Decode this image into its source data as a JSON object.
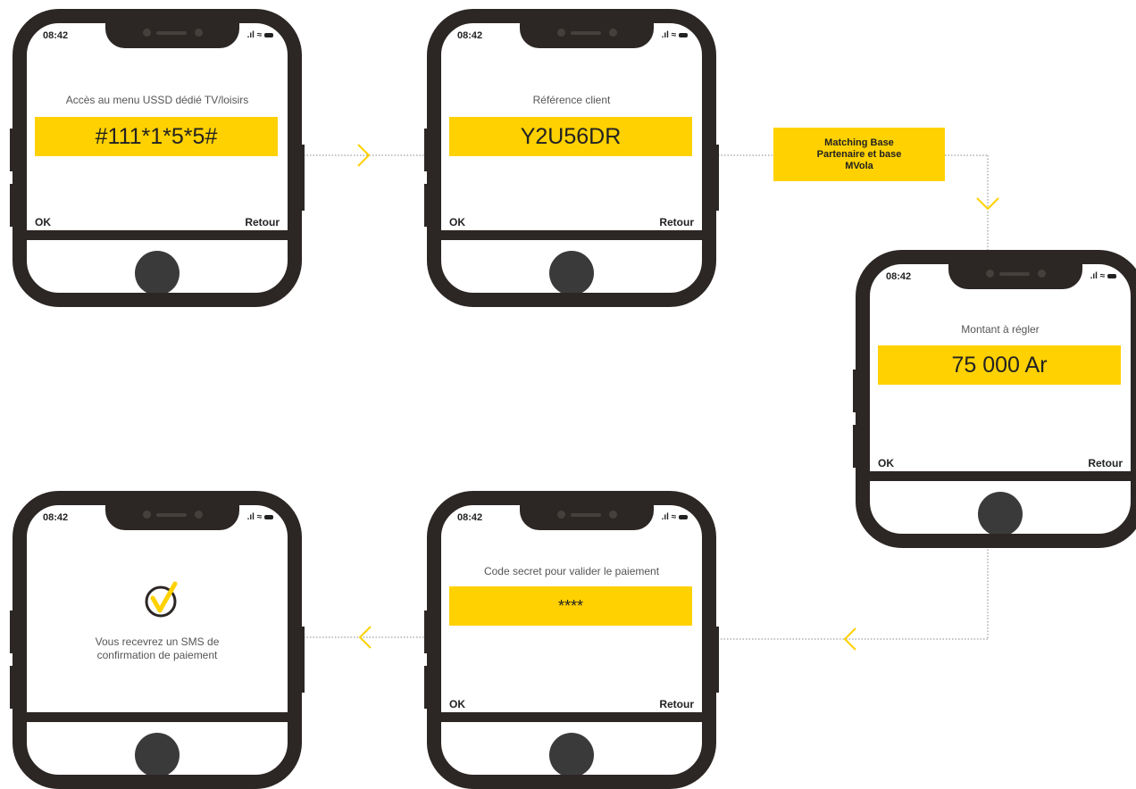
{
  "colors": {
    "frame": "#2c2624",
    "accent": "#ffd100",
    "home_button": "#3a3a3a"
  },
  "phones": [
    {
      "time": "08:42",
      "prompt": "Accès au menu USSD dédié TV/loisirs",
      "value": "#111*1*5*5#",
      "ok": "OK",
      "back": "Retour"
    },
    {
      "time": "08:42",
      "prompt": "Référence client",
      "value": "Y2U56DR",
      "ok": "OK",
      "back": "Retour"
    },
    {
      "time": "08:42",
      "prompt": "Montant à régler",
      "value": "75 000 Ar",
      "ok": "OK",
      "back": "Retour"
    },
    {
      "time": "08:42",
      "prompt": "Code secret pour valider le paiement",
      "value": "****",
      "ok": "OK",
      "back": "Retour"
    },
    {
      "time": "08:42",
      "message_line1": "Vous recevrez un SMS de",
      "message_line2": "confirmation de paiement",
      "icon": "checkmark-circle-icon"
    }
  ],
  "matching_label": {
    "line1": "Matching Base",
    "line2": "Partenaire et base",
    "line3": "MVola"
  }
}
